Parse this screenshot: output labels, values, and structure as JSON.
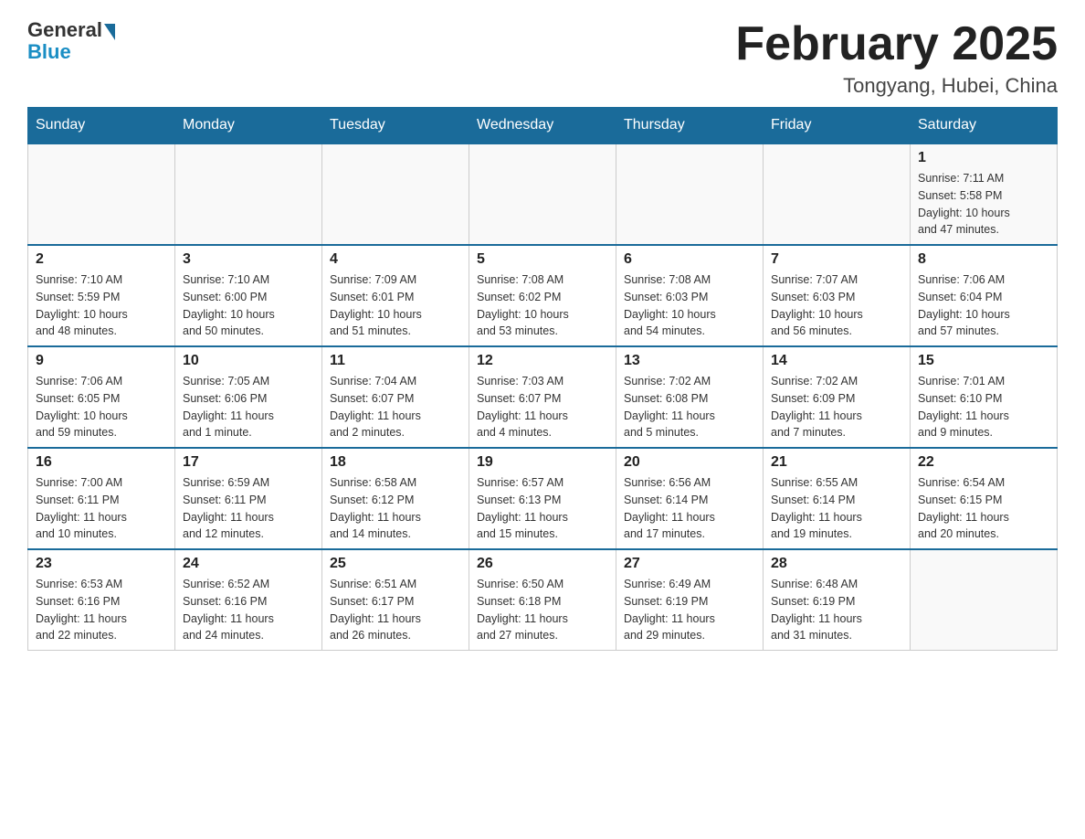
{
  "header": {
    "logo_general": "General",
    "logo_blue": "Blue",
    "title": "February 2025",
    "subtitle": "Tongyang, Hubei, China"
  },
  "weekdays": [
    "Sunday",
    "Monday",
    "Tuesday",
    "Wednesday",
    "Thursday",
    "Friday",
    "Saturday"
  ],
  "weeks": [
    [
      {
        "day": "",
        "info": ""
      },
      {
        "day": "",
        "info": ""
      },
      {
        "day": "",
        "info": ""
      },
      {
        "day": "",
        "info": ""
      },
      {
        "day": "",
        "info": ""
      },
      {
        "day": "",
        "info": ""
      },
      {
        "day": "1",
        "info": "Sunrise: 7:11 AM\nSunset: 5:58 PM\nDaylight: 10 hours\nand 47 minutes."
      }
    ],
    [
      {
        "day": "2",
        "info": "Sunrise: 7:10 AM\nSunset: 5:59 PM\nDaylight: 10 hours\nand 48 minutes."
      },
      {
        "day": "3",
        "info": "Sunrise: 7:10 AM\nSunset: 6:00 PM\nDaylight: 10 hours\nand 50 minutes."
      },
      {
        "day": "4",
        "info": "Sunrise: 7:09 AM\nSunset: 6:01 PM\nDaylight: 10 hours\nand 51 minutes."
      },
      {
        "day": "5",
        "info": "Sunrise: 7:08 AM\nSunset: 6:02 PM\nDaylight: 10 hours\nand 53 minutes."
      },
      {
        "day": "6",
        "info": "Sunrise: 7:08 AM\nSunset: 6:03 PM\nDaylight: 10 hours\nand 54 minutes."
      },
      {
        "day": "7",
        "info": "Sunrise: 7:07 AM\nSunset: 6:03 PM\nDaylight: 10 hours\nand 56 minutes."
      },
      {
        "day": "8",
        "info": "Sunrise: 7:06 AM\nSunset: 6:04 PM\nDaylight: 10 hours\nand 57 minutes."
      }
    ],
    [
      {
        "day": "9",
        "info": "Sunrise: 7:06 AM\nSunset: 6:05 PM\nDaylight: 10 hours\nand 59 minutes."
      },
      {
        "day": "10",
        "info": "Sunrise: 7:05 AM\nSunset: 6:06 PM\nDaylight: 11 hours\nand 1 minute."
      },
      {
        "day": "11",
        "info": "Sunrise: 7:04 AM\nSunset: 6:07 PM\nDaylight: 11 hours\nand 2 minutes."
      },
      {
        "day": "12",
        "info": "Sunrise: 7:03 AM\nSunset: 6:07 PM\nDaylight: 11 hours\nand 4 minutes."
      },
      {
        "day": "13",
        "info": "Sunrise: 7:02 AM\nSunset: 6:08 PM\nDaylight: 11 hours\nand 5 minutes."
      },
      {
        "day": "14",
        "info": "Sunrise: 7:02 AM\nSunset: 6:09 PM\nDaylight: 11 hours\nand 7 minutes."
      },
      {
        "day": "15",
        "info": "Sunrise: 7:01 AM\nSunset: 6:10 PM\nDaylight: 11 hours\nand 9 minutes."
      }
    ],
    [
      {
        "day": "16",
        "info": "Sunrise: 7:00 AM\nSunset: 6:11 PM\nDaylight: 11 hours\nand 10 minutes."
      },
      {
        "day": "17",
        "info": "Sunrise: 6:59 AM\nSunset: 6:11 PM\nDaylight: 11 hours\nand 12 minutes."
      },
      {
        "day": "18",
        "info": "Sunrise: 6:58 AM\nSunset: 6:12 PM\nDaylight: 11 hours\nand 14 minutes."
      },
      {
        "day": "19",
        "info": "Sunrise: 6:57 AM\nSunset: 6:13 PM\nDaylight: 11 hours\nand 15 minutes."
      },
      {
        "day": "20",
        "info": "Sunrise: 6:56 AM\nSunset: 6:14 PM\nDaylight: 11 hours\nand 17 minutes."
      },
      {
        "day": "21",
        "info": "Sunrise: 6:55 AM\nSunset: 6:14 PM\nDaylight: 11 hours\nand 19 minutes."
      },
      {
        "day": "22",
        "info": "Sunrise: 6:54 AM\nSunset: 6:15 PM\nDaylight: 11 hours\nand 20 minutes."
      }
    ],
    [
      {
        "day": "23",
        "info": "Sunrise: 6:53 AM\nSunset: 6:16 PM\nDaylight: 11 hours\nand 22 minutes."
      },
      {
        "day": "24",
        "info": "Sunrise: 6:52 AM\nSunset: 6:16 PM\nDaylight: 11 hours\nand 24 minutes."
      },
      {
        "day": "25",
        "info": "Sunrise: 6:51 AM\nSunset: 6:17 PM\nDaylight: 11 hours\nand 26 minutes."
      },
      {
        "day": "26",
        "info": "Sunrise: 6:50 AM\nSunset: 6:18 PM\nDaylight: 11 hours\nand 27 minutes."
      },
      {
        "day": "27",
        "info": "Sunrise: 6:49 AM\nSunset: 6:19 PM\nDaylight: 11 hours\nand 29 minutes."
      },
      {
        "day": "28",
        "info": "Sunrise: 6:48 AM\nSunset: 6:19 PM\nDaylight: 11 hours\nand 31 minutes."
      },
      {
        "day": "",
        "info": ""
      }
    ]
  ]
}
